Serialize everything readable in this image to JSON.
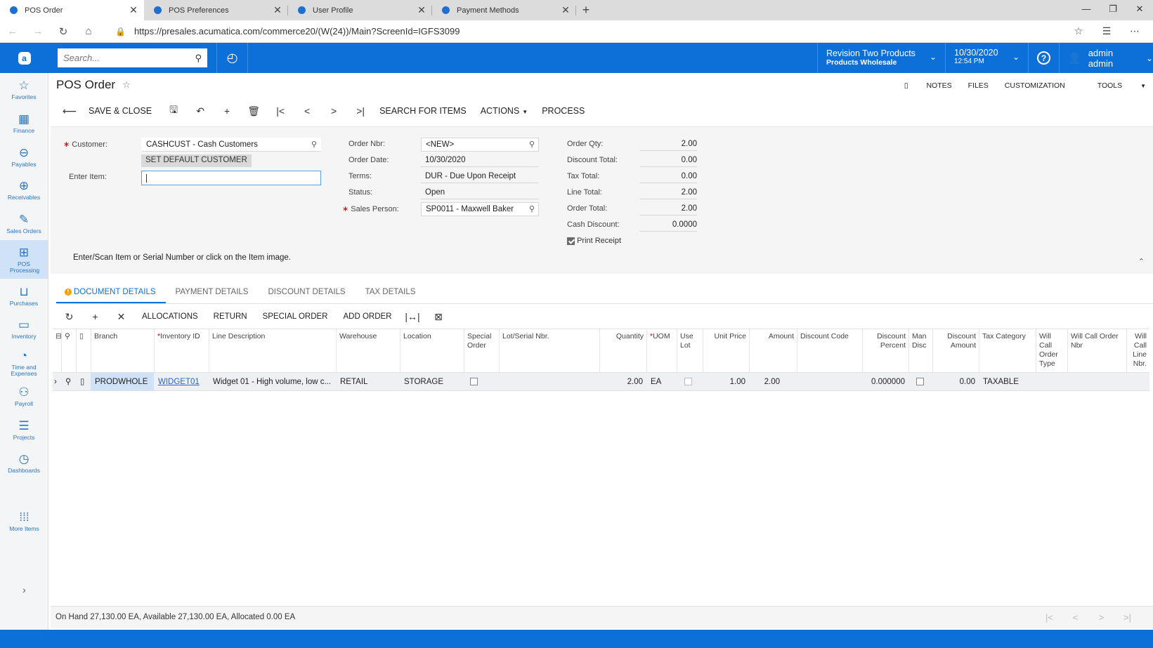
{
  "browser": {
    "tabs": [
      {
        "title": "POS Order",
        "active": true
      },
      {
        "title": "POS Preferences",
        "active": false
      },
      {
        "title": "User Profile",
        "active": false
      },
      {
        "title": "Payment Methods",
        "active": false
      }
    ],
    "url": "https://presales.acumatica.com/commerce20/(W(24))/Main?ScreenId=IGFS3099"
  },
  "header": {
    "search_placeholder": "Search...",
    "company_line1": "Revision Two Products",
    "company_line2": "Products Wholesale",
    "date": "10/30/2020",
    "time": "12:54 PM",
    "user": "admin admin"
  },
  "leftnav": {
    "items": [
      {
        "label": "Favorites",
        "icon": "☆"
      },
      {
        "label": "Finance",
        "icon": "▦"
      },
      {
        "label": "Payables",
        "icon": "⊖"
      },
      {
        "label": "Receivables",
        "icon": "⊕"
      },
      {
        "label": "Sales Orders",
        "icon": "✎"
      },
      {
        "label": "POS Processing",
        "icon": "🛒"
      },
      {
        "label": "Purchases",
        "icon": "🛒"
      },
      {
        "label": "Inventory",
        "icon": "⛟"
      },
      {
        "label": "Time and Expenses",
        "icon": "⏱"
      },
      {
        "label": "Payroll",
        "icon": "👥"
      },
      {
        "label": "Projects",
        "icon": "☰"
      },
      {
        "label": "Dashboards",
        "icon": "◷"
      }
    ],
    "more_label": "More Items"
  },
  "screen": {
    "title": "POS Order",
    "top_links": [
      "NOTES",
      "FILES",
      "CUSTOMIZATION",
      "TOOLS"
    ],
    "toolbar": {
      "save_close": "SAVE & CLOSE",
      "search_items": "SEARCH FOR ITEMS",
      "actions": "ACTIONS",
      "process": "PROCESS"
    }
  },
  "form": {
    "customer_label": "Customer:",
    "customer_value": "CASHCUST - Cash Customers",
    "set_default_btn": "SET DEFAULT CUSTOMER",
    "enter_item_label": "Enter Item:",
    "order_nbr_label": "Order Nbr:",
    "order_nbr_value": "<NEW>",
    "order_date_label": "Order Date:",
    "order_date_value": "10/30/2020",
    "terms_label": "Terms:",
    "terms_value": "DUR - Due Upon Receipt",
    "status_label": "Status:",
    "status_value": "Open",
    "sales_person_label": "Sales Person:",
    "sales_person_value": "SP0011 - Maxwell Baker",
    "order_qty_label": "Order Qty:",
    "order_qty_value": "2.00",
    "discount_total_label": "Discount Total:",
    "discount_total_value": "0.00",
    "tax_total_label": "Tax Total:",
    "tax_total_value": "0.00",
    "line_total_label": "Line Total:",
    "line_total_value": "2.00",
    "order_total_label": "Order Total:",
    "order_total_value": "2.00",
    "cash_discount_label": "Cash Discount:",
    "cash_discount_value": "0.0000",
    "print_receipt_label": "Print Receipt",
    "print_receipt_checked": true,
    "scan_message": "Enter/Scan Item or Serial Number or click on the Item image."
  },
  "tabs": [
    "DOCUMENT DETAILS",
    "PAYMENT DETAILS",
    "DISCOUNT DETAILS",
    "TAX DETAILS"
  ],
  "grid_toolbar": [
    "ALLOCATIONS",
    "RETURN",
    "SPECIAL ORDER",
    "ADD ORDER"
  ],
  "grid": {
    "columns": [
      "Branch",
      "Inventory ID",
      "Line Description",
      "Warehouse",
      "Location",
      "Special Order",
      "Lot/Serial Nbr.",
      "Quantity",
      "UOM",
      "Use Lot",
      "Unit Price",
      "Amount",
      "Discount Code",
      "Discount Percent",
      "Man Disc",
      "Discount Amount",
      "Tax Category",
      "Will Call Order Type",
      "Will Call Order Nbr",
      "Will Call Line Nbr."
    ],
    "rows": [
      {
        "branch": "PRODWHOLE",
        "inventory_id": "WIDGET01",
        "description": "Widget 01 - High volume, low c...",
        "warehouse": "RETAIL",
        "location": "STORAGE",
        "quantity": "2.00",
        "uom": "EA",
        "unit_price": "1.00",
        "amount": "2.00",
        "discount_percent": "0.000000",
        "discount_amount": "0.00",
        "tax_category": "TAXABLE"
      }
    ]
  },
  "footer": {
    "status": "On Hand 27,130.00 EA, Available 27,130.00 EA, Allocated 0.00 EA"
  }
}
